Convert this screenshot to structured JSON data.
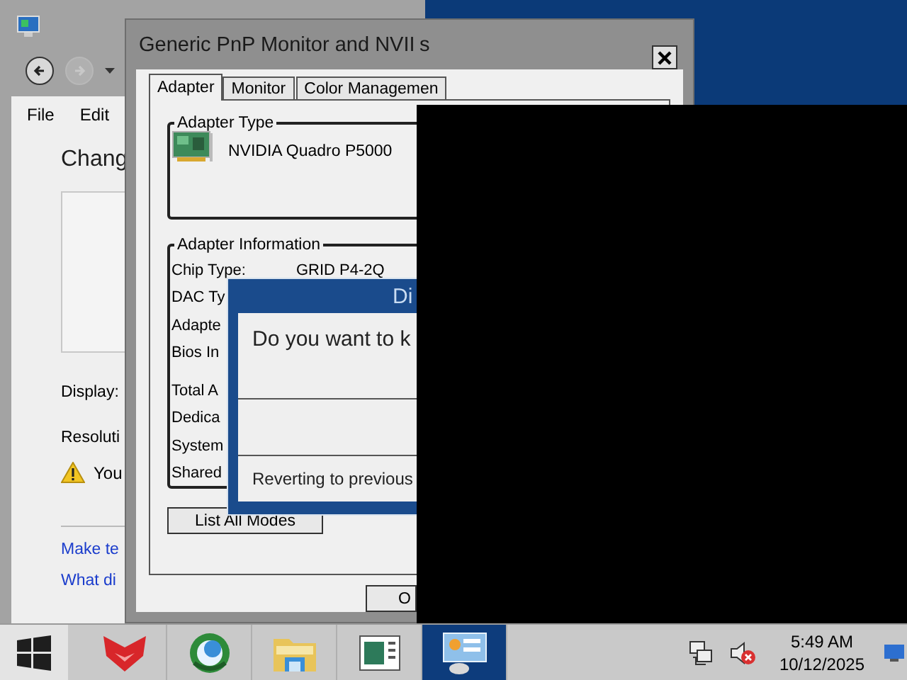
{
  "control_panel": {
    "menu": [
      "File",
      "Edit"
    ],
    "heading": "Chang",
    "display_label": "Display:",
    "resolution_label": "Resoluti",
    "warning": "You",
    "links": [
      "Make te",
      "What di"
    ]
  },
  "properties_dialog": {
    "title": "Generic PnP Monitor and NVII",
    "title_tail": "s",
    "tabs": [
      {
        "label": "Adapter",
        "selected": true
      },
      {
        "label": "Monitor",
        "selected": false
      },
      {
        "label": "Color Managemen",
        "selected": false
      }
    ],
    "adapter_type": {
      "legend": "Adapter Type",
      "name": "NVIDIA Quadro P5000"
    },
    "adapter_info": {
      "legend": "Adapter Information",
      "rows": [
        {
          "label": "Chip Type:",
          "value": "GRID P4-2Q"
        },
        {
          "label": "DAC Ty"
        },
        {
          "label": "Adapte"
        },
        {
          "label": "Bios In"
        }
      ],
      "memory_rows": [
        {
          "label": "Total A"
        },
        {
          "label": "Dedica"
        },
        {
          "label": "System"
        },
        {
          "label": "Shared"
        }
      ]
    },
    "list_modes_button": "List All Modes",
    "ok_button": "O"
  },
  "confirm_dialog": {
    "title": "Di",
    "question": "Do you want to k",
    "countdown": "Reverting to previous"
  },
  "taskbar": {
    "apps": [
      {
        "kind": "fox",
        "active": false
      },
      {
        "kind": "globe",
        "active": false
      },
      {
        "kind": "folder",
        "active": false
      },
      {
        "kind": "document",
        "active": false
      },
      {
        "kind": "display",
        "active": true
      }
    ],
    "time": "5:49 AM",
    "date": "10/12/2025"
  }
}
